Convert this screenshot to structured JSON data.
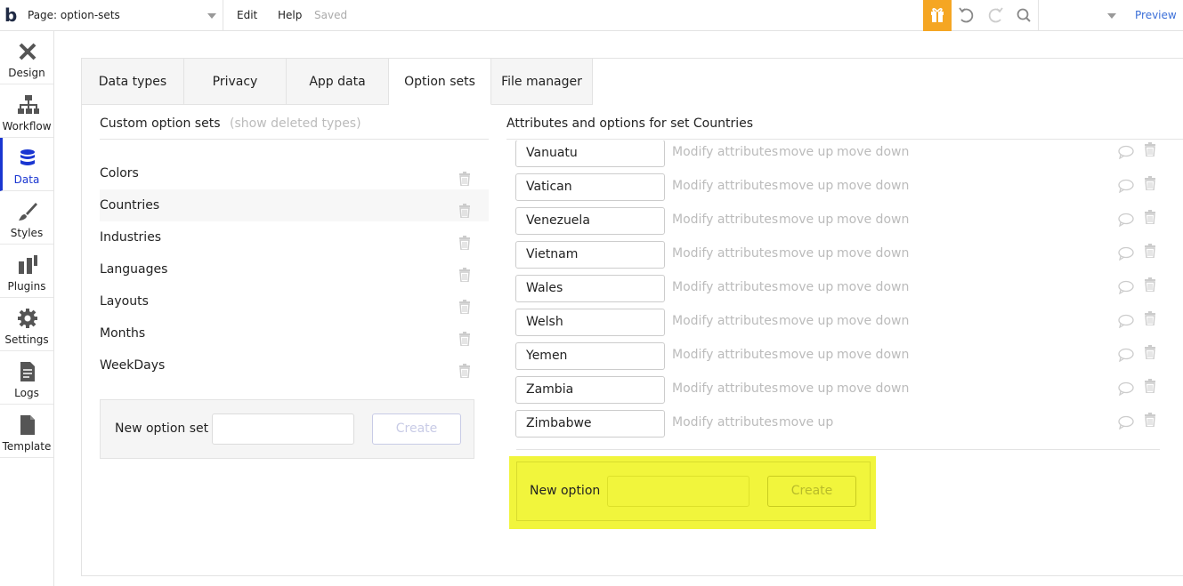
{
  "topbar": {
    "logo": "b",
    "page_select": "Page: option-sets",
    "edit": "Edit",
    "help": "Help",
    "saved": "Saved",
    "preview": "Preview"
  },
  "sidebar": {
    "items": [
      {
        "label": "Design"
      },
      {
        "label": "Workflow"
      },
      {
        "label": "Data"
      },
      {
        "label": "Styles"
      },
      {
        "label": "Plugins"
      },
      {
        "label": "Settings"
      },
      {
        "label": "Logs"
      },
      {
        "label": "Template"
      }
    ]
  },
  "tabs": [
    {
      "label": "Data types"
    },
    {
      "label": "Privacy"
    },
    {
      "label": "App data"
    },
    {
      "label": "Option sets"
    },
    {
      "label": "File manager"
    }
  ],
  "left": {
    "title": "Custom option sets",
    "show_deleted": "(show deleted types)",
    "sets": [
      "Colors",
      "Countries",
      "Industries",
      "Languages",
      "Layouts",
      "Months",
      "WeekDays"
    ],
    "selected_set": "Countries",
    "new_label": "New option set",
    "create": "Create"
  },
  "right": {
    "title": "Attributes and options for set Countries",
    "partial_option": "Vanuatu",
    "options": [
      "Vatican",
      "Venezuela",
      "Vietnam",
      "Wales",
      "Welsh",
      "Yemen",
      "Zambia",
      "Zimbabwe"
    ],
    "modify": "Modify attributes",
    "move_up": "move up",
    "move_down": "move down",
    "new_label": "New option",
    "create": "Create"
  },
  "colors": {
    "accent": "#1a36d1",
    "gift": "#f5a623",
    "highlight": "#f1f53c",
    "link_blue": "#3b6fd8"
  }
}
